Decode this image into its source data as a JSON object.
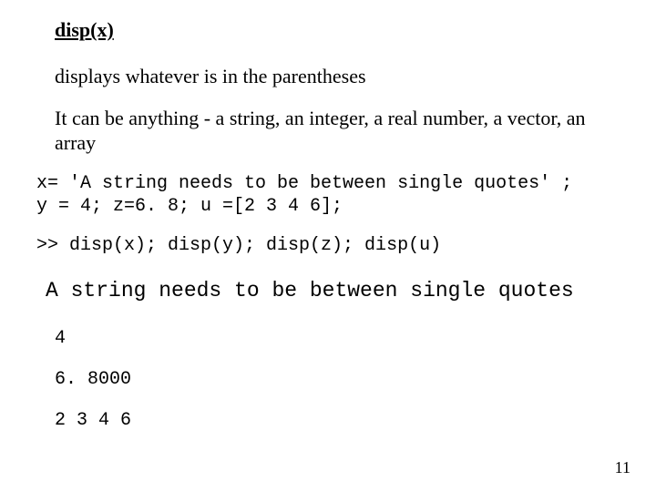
{
  "title": "disp(x)",
  "para1": "displays whatever is in the parentheses",
  "para2": "It can be anything - a string, an integer, a real number, a vector, an array",
  "code1_line1": "x= 'A string needs to be between single quotes' ;",
  "code1_line2": "y = 4; z=6. 8; u =[2 3 4 6];",
  "code2": ">> disp(x); disp(y); disp(z); disp(u)",
  "output_string": "A string needs to be between single quotes",
  "output_y": "4",
  "output_z": "6. 8000",
  "output_u": "2 3 4 6",
  "page_number": "11"
}
